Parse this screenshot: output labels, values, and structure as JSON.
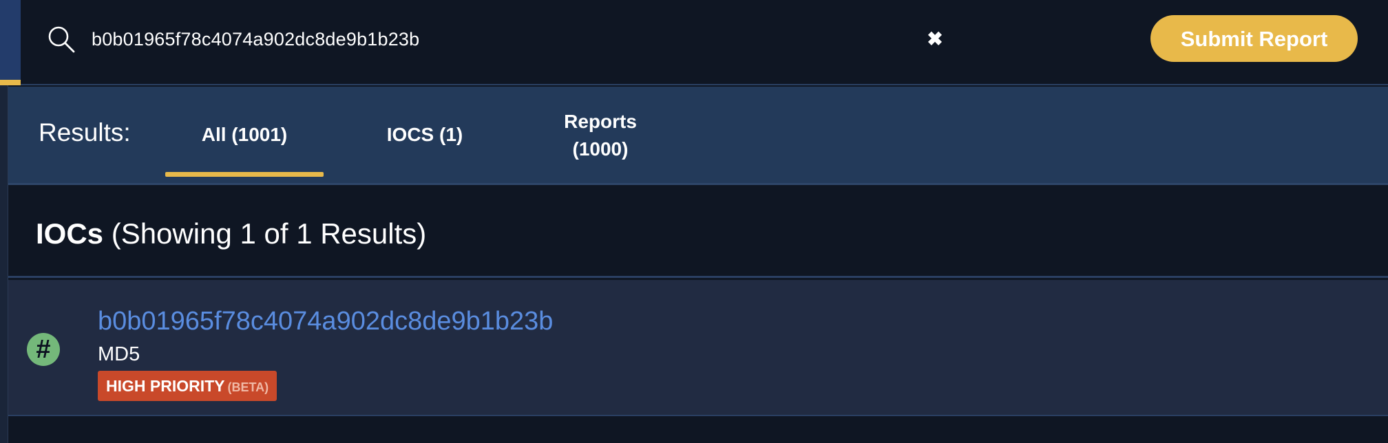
{
  "header": {
    "search_value": "b0b01965f78c4074a902dc8de9b1b23b",
    "clear_icon": "close-icon",
    "submit_label": "Submit Report"
  },
  "tabs": {
    "results_label": "Results:",
    "items": [
      {
        "label": "All (1001)",
        "active": true
      },
      {
        "label": "IOCS (1)",
        "active": false
      },
      {
        "label_line1": "Reports",
        "label_line2": "(1000)",
        "active": false
      }
    ]
  },
  "section": {
    "title_bold": "IOCs",
    "title_rest": "(Showing 1 of 1 Results)"
  },
  "results": [
    {
      "icon": "hash-icon",
      "value": "b0b01965f78c4074a902dc8de9b1b23b",
      "type": "MD5",
      "badge": "HIGH PRIORITY",
      "badge_suffix": "(BETA)"
    }
  ],
  "colors": {
    "accent": "#e8b94a",
    "link": "#5a8de0",
    "badge": "#c9492a",
    "hash_icon_bg": "#74b87a",
    "tab_bar_bg": "#233a5a",
    "page_bg": "#0f1623",
    "row_bg": "#212b42"
  }
}
